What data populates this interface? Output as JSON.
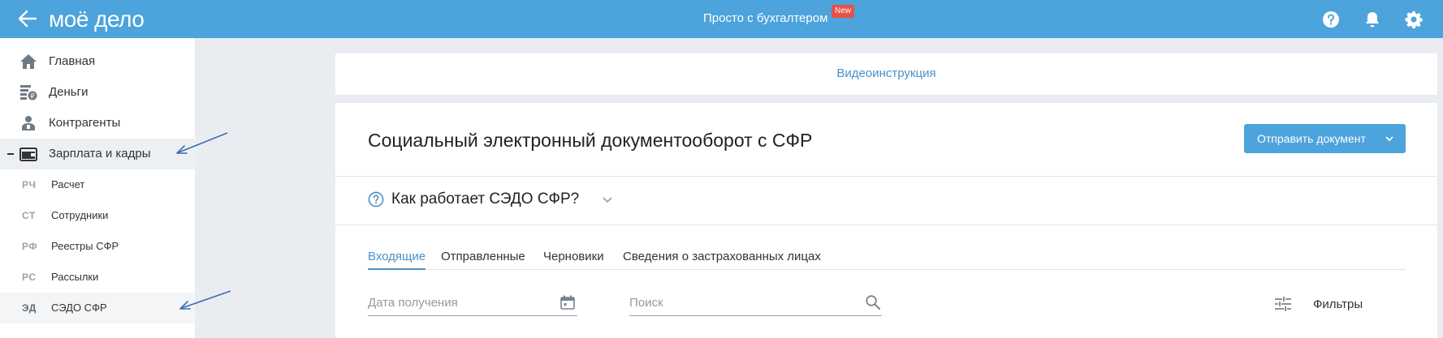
{
  "header": {
    "logo_text": "моё дело",
    "promo_text": "Просто с бухгалтером",
    "new_badge": "New",
    "icons": [
      "back-arrow-icon",
      "help-icon",
      "bell-icon",
      "gear-icon"
    ],
    "bar_color": "#4da3dc"
  },
  "sidebar": {
    "items": [
      {
        "label": "Главная",
        "icon": "home-icon"
      },
      {
        "label": "Деньги",
        "icon": "money-icon"
      },
      {
        "label": "Контрагенты",
        "icon": "contractors-icon"
      },
      {
        "label": "Зарплата и кадры",
        "icon": "wallet-icon",
        "expanded": true
      }
    ],
    "subitems": [
      {
        "abbr": "РЧ",
        "label": "Расчет"
      },
      {
        "abbr": "СТ",
        "label": "Сотрудники"
      },
      {
        "abbr": "РФ",
        "label": "Реестры СФР"
      },
      {
        "abbr": "РС",
        "label": "Рассылки"
      },
      {
        "abbr": "ЭД",
        "label": "СЭДО СФР",
        "active": true
      }
    ]
  },
  "main": {
    "video_link": "Видеоинструкция",
    "title": "Социальный электронный документооборот с СФР",
    "send_button": "Отправить документ",
    "how_title": "Как работает СЭДО СФР?",
    "tabs": [
      {
        "label": "Входящие",
        "active": true
      },
      {
        "label": "Отправленные"
      },
      {
        "label": "Черновики"
      },
      {
        "label": "Сведения о застрахованных лицах"
      }
    ],
    "date_placeholder": "Дата получения",
    "search_placeholder": "Поиск",
    "filters_label": "Фильтры",
    "accent_color": "#4a90c8"
  }
}
